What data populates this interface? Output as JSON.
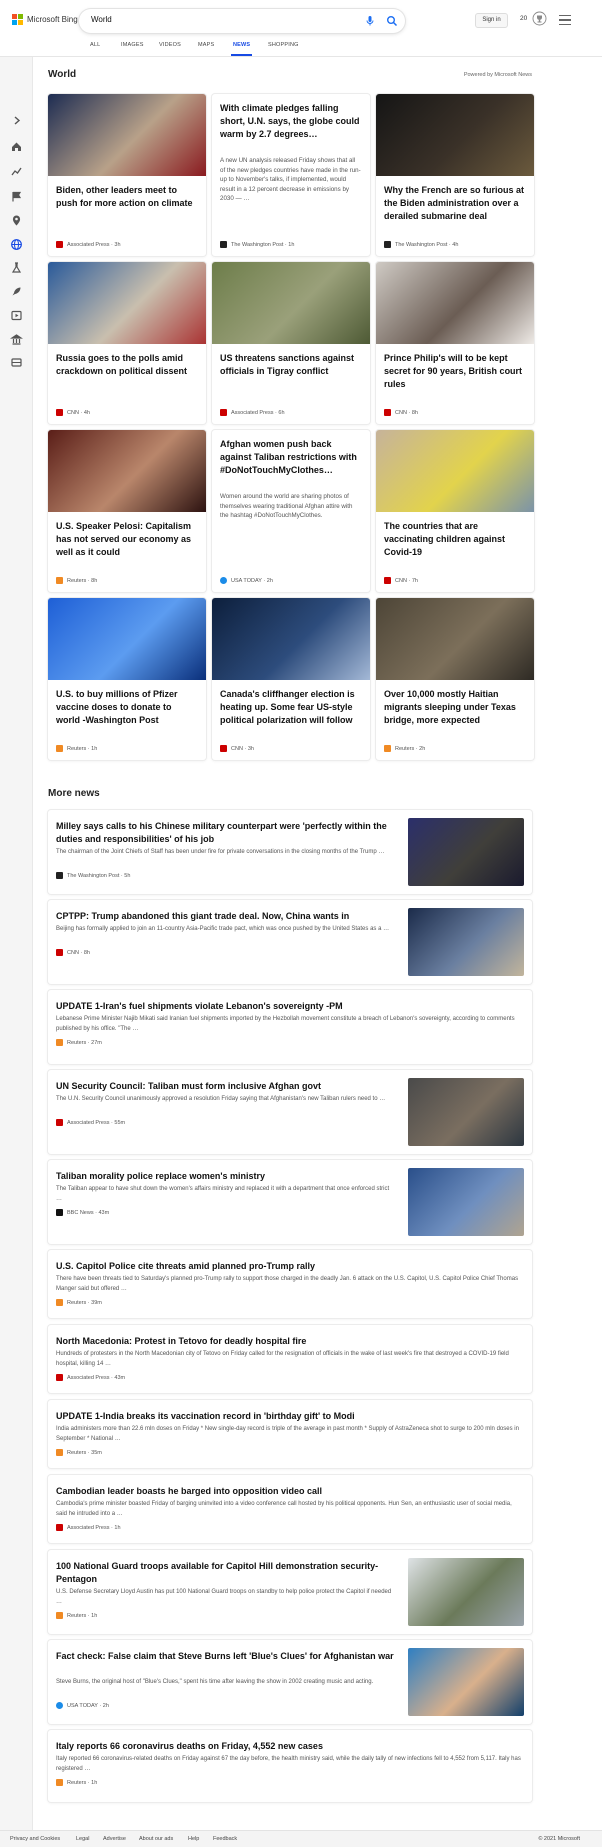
{
  "header": {
    "logo_text": "Microsoft Bing",
    "search_value": "World",
    "signin_label": "Sign in",
    "points": "20",
    "colors": {
      "ms_red": "#f25022",
      "ms_green": "#7fba00",
      "ms_blue": "#00a4ef",
      "ms_yellow": "#ffb900",
      "accent": "#174ae4"
    }
  },
  "tabs": [
    {
      "label": "ALL"
    },
    {
      "label": "IMAGES"
    },
    {
      "label": "VIDEOS"
    },
    {
      "label": "MAPS"
    },
    {
      "label": "NEWS",
      "active": true
    },
    {
      "label": "SHOPPING"
    }
  ],
  "sidebar_icons": [
    "chevron-right-icon",
    "home-icon",
    "trending-icon",
    "flag-icon",
    "location-icon",
    "globe-icon",
    "science-icon",
    "rocket-icon",
    "entertainment-icon",
    "money-icon",
    "sports-icon"
  ],
  "section": {
    "title": "World",
    "powered_by": "Powered by Microsoft News"
  },
  "cards": [
    {
      "title": "Biden, other leaders meet to push for more action on climate",
      "snippet": "",
      "source": "Associated Press",
      "time": "3h",
      "src_icon": "AP",
      "src_color": "#cc0000",
      "has_image": true,
      "img_colors": [
        "#1d2c52",
        "#b8a189",
        "#8a1a1f"
      ]
    },
    {
      "title": "With climate pledges falling short, U.N. says, the globe could warm by 2.7 degrees…",
      "snippet": "A new UN analysis released Friday shows that all of the new pledges countries have made in the run-up to November's talks, if implemented, would result in a 12 percent decrease in emissions by 2030 — …",
      "source": "The Washington Post",
      "time": "1h",
      "src_icon": "wp",
      "src_color": "#222222",
      "has_image": false
    },
    {
      "title": "Why the French are so furious at the Biden administration over a derailed submarine deal",
      "snippet": "",
      "source": "The Washington Post",
      "time": "4h",
      "src_icon": "wp",
      "src_color": "#222222",
      "has_image": true,
      "img_colors": [
        "#151515",
        "#3a3128",
        "#6b5a3d"
      ]
    },
    {
      "title": "Russia goes to the polls amid crackdown on political dissent",
      "snippet": "",
      "source": "CNN",
      "time": "4h",
      "src_icon": "CNN",
      "src_color": "#cc0000",
      "has_image": true,
      "img_colors": [
        "#2a5a9a",
        "#c9bfae",
        "#a33"
      ]
    },
    {
      "title": "US threatens sanctions against officials in Tigray conflict",
      "snippet": "",
      "source": "Associated Press",
      "time": "6h",
      "src_icon": "AP",
      "src_color": "#cc0000",
      "has_image": true,
      "img_colors": [
        "#6d7d4a",
        "#9aa07a",
        "#4e5a35"
      ]
    },
    {
      "title": "Prince Philip's will to be kept secret for 90 years, British court rules",
      "snippet": "",
      "source": "CNN",
      "time": "8h",
      "src_icon": "CNN",
      "src_color": "#cc0000",
      "has_image": true,
      "img_colors": [
        "#cfcac4",
        "#6b5d54",
        "#eeeae6"
      ]
    },
    {
      "title": "U.S. Speaker Pelosi: Capitalism has not served our economy as well as it could",
      "snippet": "",
      "source": "Reuters",
      "time": "8h",
      "src_icon": "R",
      "src_color": "#f08a24",
      "has_image": true,
      "img_colors": [
        "#5a1e18",
        "#b9866b",
        "#2c1210"
      ]
    },
    {
      "title": "Afghan women push back against Taliban restrictions with #DoNotTouchMyClothes…",
      "snippet": "Women around the world are sharing photos of themselves wearing traditional Afghan attire with the hashtag #DoNotTouchMyClothes.",
      "source": "USA TODAY",
      "time": "2h",
      "src_icon": "",
      "src_color": "#1b8ce8",
      "has_image": false
    },
    {
      "title": "The countries that are vaccinating children against Covid-19",
      "snippet": "",
      "source": "CNN",
      "time": "7h",
      "src_icon": "CNN",
      "src_color": "#cc0000",
      "has_image": true,
      "img_colors": [
        "#c6b39a",
        "#e2d34c",
        "#7b93a8"
      ]
    },
    {
      "title": "U.S. to buy millions of Pfizer vaccine doses to donate to world -Washington Post",
      "snippet": "",
      "source": "Reuters",
      "time": "1h",
      "src_icon": "R",
      "src_color": "#f08a24",
      "has_image": true,
      "img_colors": [
        "#1e5fd6",
        "#5c9cf0",
        "#0a2f7a"
      ]
    },
    {
      "title": "Canada's cliffhanger election is heating up. Some fear US-style political polarization will follow",
      "snippet": "",
      "source": "CNN",
      "time": "3h",
      "src_icon": "CNN",
      "src_color": "#cc0000",
      "has_image": true,
      "img_colors": [
        "#0d1f3c",
        "#2d4c7c",
        "#a3b8d6"
      ]
    },
    {
      "title": "Over 10,000 mostly Haitian migrants sleeping under Texas bridge, more expected",
      "snippet": "",
      "source": "Reuters",
      "time": "2h",
      "src_icon": "R",
      "src_color": "#f08a24",
      "has_image": true,
      "img_colors": [
        "#4d4537",
        "#7c6f5a",
        "#2e2a24"
      ]
    }
  ],
  "more_news": {
    "title": "More news",
    "items": [
      {
        "title": "Milley says calls to his Chinese military counterpart were 'perfectly within the duties and responsibilities' of his job",
        "snippet": "The chairman of the Joint Chiefs of Staff has been under fire for private conversations in the closing months of the Trump …",
        "source": "The Washington Post",
        "time": "5h",
        "src_icon": "wp",
        "src_color": "#222222",
        "has_image": true,
        "img_colors": [
          "#2b2f6b",
          "#403f3a",
          "#1a1a2e"
        ]
      },
      {
        "title": "CPTPP: Trump abandoned this giant trade deal. Now, China wants in",
        "snippet": "Beijing has formally applied to join an 11-country Asia-Pacific trade pact, which was once pushed by the United States as a …",
        "source": "CNN",
        "time": "8h",
        "src_icon": "CNN",
        "src_color": "#cc0000",
        "has_image": true,
        "img_colors": [
          "#1b2b4a",
          "#6a7fa0",
          "#c2b59c"
        ]
      },
      {
        "title": "UPDATE 1-Iran's fuel shipments violate Lebanon's sovereignty -PM",
        "snippet": "Lebanese Prime Minister Najib Mikati said Iranian fuel shipments imported by the Hezbollah movement constitute a breach of Lebanon's sovereignty, according to comments published by his office. \"The …",
        "source": "Reuters",
        "time": "27m",
        "src_icon": "R",
        "src_color": "#f08a24",
        "has_image": false
      },
      {
        "title": "UN Security Council: Taliban must form inclusive Afghan govt",
        "snippet": "The U.N. Security Council unanimously approved a resolution Friday saying that Afghanistan's new Taliban rulers need to …",
        "source": "Associated Press",
        "time": "55m",
        "src_icon": "AP",
        "src_color": "#cc0000",
        "has_image": true,
        "img_colors": [
          "#4a4a4a",
          "#7a6e60",
          "#2c3640"
        ]
      },
      {
        "title": "Taliban morality police replace women's ministry",
        "snippet": "The Taliban appear to have shut down the women's affairs ministry and replaced it with a department that once enforced strict …",
        "source": "BBC News",
        "time": "43m",
        "src_icon": "BBC",
        "src_color": "#111111",
        "has_image": true,
        "img_colors": [
          "#2a4f8a",
          "#6f8fbf",
          "#b0a490"
        ]
      },
      {
        "title": "U.S. Capitol Police cite threats amid planned pro-Trump rally",
        "snippet": "There have been threats tied to Saturday's planned pro-Trump rally to support those charged in the deadly Jan. 6 attack on the U.S. Capitol, U.S. Capitol Police Chief Thomas Manger said but offered …",
        "source": "Reuters",
        "time": "39m",
        "src_icon": "R",
        "src_color": "#f08a24",
        "has_image": false
      },
      {
        "title": "North Macedonia: Protest in Tetovo for deadly hospital fire",
        "snippet": "Hundreds of protesters in the North Macedonian city of Tetovo on Friday called for the resignation of officials in the wake of last week's fire that destroyed a COVID-19 field hospital, killing 14 …",
        "source": "Associated Press",
        "time": "43m",
        "src_icon": "AP",
        "src_color": "#cc0000",
        "has_image": false
      },
      {
        "title": "UPDATE 1-India breaks its vaccination record in 'birthday gift' to Modi",
        "snippet": "India administers more than 22.6 mln doses on Friday * New single-day record is triple of the average in past month * Supply of AstraZeneca shot to surge to 200 mln doses in September * National …",
        "source": "Reuters",
        "time": "35m",
        "src_icon": "R",
        "src_color": "#f08a24",
        "has_image": false
      },
      {
        "title": "Cambodian leader boasts he barged into opposition video call",
        "snippet": "Cambodia's prime minister boasted Friday of barging uninvited into a video conference call hosted by his political opponents. Hun Sen, an enthusiastic user of social media, said he intruded into a …",
        "source": "Associated Press",
        "time": "1h",
        "src_icon": "AP",
        "src_color": "#cc0000",
        "has_image": false
      },
      {
        "title": "100 National Guard troops available for Capitol Hill demonstration security-Pentagon",
        "snippet": "U.S. Defense Secretary Lloyd Austin has put 100 National Guard troops on standby to help police protect the Capitol if needed …",
        "source": "Reuters",
        "time": "1h",
        "src_icon": "R",
        "src_color": "#f08a24",
        "has_image": true,
        "img_colors": [
          "#dfe3e6",
          "#6b7a5a",
          "#9aa3ab"
        ]
      },
      {
        "title": "Fact check: False claim that Steve Burns left 'Blue's Clues' for Afghanistan war",
        "snippet": "Steve Burns, the original host of \"Blue's Clues,\" spent his time after leaving the show in 2002 creating music and acting.",
        "source": "USA TODAY",
        "time": "2h",
        "src_icon": "",
        "src_color": "#1b8ce8",
        "has_image": true,
        "img_colors": [
          "#2f7fc2",
          "#d9b08c",
          "#123f6b"
        ]
      },
      {
        "title": "Italy reports 66 coronavirus deaths on Friday, 4,552 new cases",
        "snippet": "Italy reported 66 coronavirus-related deaths on Friday against 67 the day before, the health ministry said, while the daily tally of new infections fell to 4,552 from 5,117. Italy has registered …",
        "source": "Reuters",
        "time": "1h",
        "src_icon": "R",
        "src_color": "#f08a24",
        "has_image": false
      }
    ]
  },
  "footer": {
    "links": [
      "Privacy and Cookies",
      "Legal",
      "Advertise",
      "About our ads",
      "Help",
      "Feedback"
    ],
    "copyright": "© 2021 Microsoft"
  }
}
